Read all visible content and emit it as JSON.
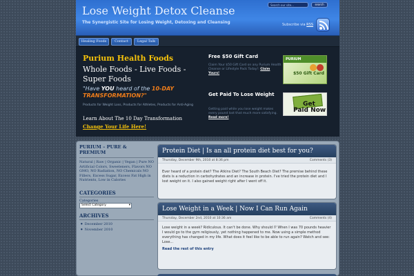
{
  "header": {
    "title": "Lose Weight Detox Cleanse",
    "tagline": "The Synergistic Site for Losing Weight, Detoxing and Cleansing",
    "search_placeholder": "Search our site...",
    "search_button": "search",
    "subscribe_text": "Subscribe via",
    "subscribe_link": "RSS"
  },
  "nav": {
    "tabs": [
      {
        "label": "Healing Foods"
      },
      {
        "label": "Contact"
      },
      {
        "label": "Legal Talk"
      }
    ]
  },
  "promo": {
    "brand": "Purium Health Foods",
    "subtitle": "Whole Foods - Live Foods - Super Foods",
    "quote_pre": "\"Have ",
    "quote_you": "YOU",
    "quote_mid": " heard of the ",
    "quote_orange1": "10-DAY",
    "quote_orange2": "TRANSFORMATION?\"",
    "small_text": "Products for Weight Loss, Products for Athletes, Products for Anti-Aging",
    "learn": "Learn About The 10 Day Transformation",
    "learn_link": "Change Your Life Here!",
    "gift_title": "Free $50 Gift Card",
    "gift_body": "Claim Your $50 Gift Card on any Purium Health Cleanse or Lifestyle Pack Today!:",
    "gift_link": "Claim Yours!",
    "gift_card_brand": "PURIUM",
    "gift_card_amount": "$50 Gift Card",
    "paid_title": "Get Paid To Lose Weight",
    "paid_body": "Getting paid while you lose weight makes every pound lost that much more satisfying.",
    "paid_link": "Read more!",
    "paid_img_line1": "Get",
    "paid_img_line2": "Paid Now"
  },
  "sidebar": {
    "title": "PURIUM – PURE & PREMIUM",
    "text": "Natural | Raw | Organic | Vegan | Pure NO Artificial Colors, Sweeteners, Flavors NO GMO, NO Radiation, NO Chemicals NO Fillers, Excess Sugar, Excess Fat High in Nutrients, Low in Calories",
    "categories_heading": "CATEGORIES",
    "categories_label": "Categories",
    "categories_select": "Select Category",
    "archives_heading": "ARCHIVES",
    "archives": [
      "December 2010",
      "November 2010"
    ]
  },
  "posts": [
    {
      "title": "Protein Diet | Is an all protein diet best for you?",
      "date": "Thursday, December 9th, 2010 at 8:36 pm",
      "comments": "Comments (3)",
      "body": "Ever heard of a protein diet? The Atkins Diet? The South Beach Diet? The premise behind these diets is a reduction in carbohydrates and an increase in protein. I've tried the protein diet and I lost weight on it. I also gained weight right after I went off it."
    },
    {
      "title": "Lose Weight in a Week | Now I Can Run Again",
      "date": "Thursday, December 2nd, 2010 at 10:36 am",
      "comments": "Comments (4)",
      "body": "Lose weight in a week? Ridiculous. It can't be done. Why should I? When I was 70 pounds heavier I would go to the gym religiously, yet nothing happened to me. Now using a simple method everything has changed in my life. What does it feel like to be able to run again? Watch and see: Lose...",
      "read_more": "Read the rest of this entry"
    }
  ]
}
